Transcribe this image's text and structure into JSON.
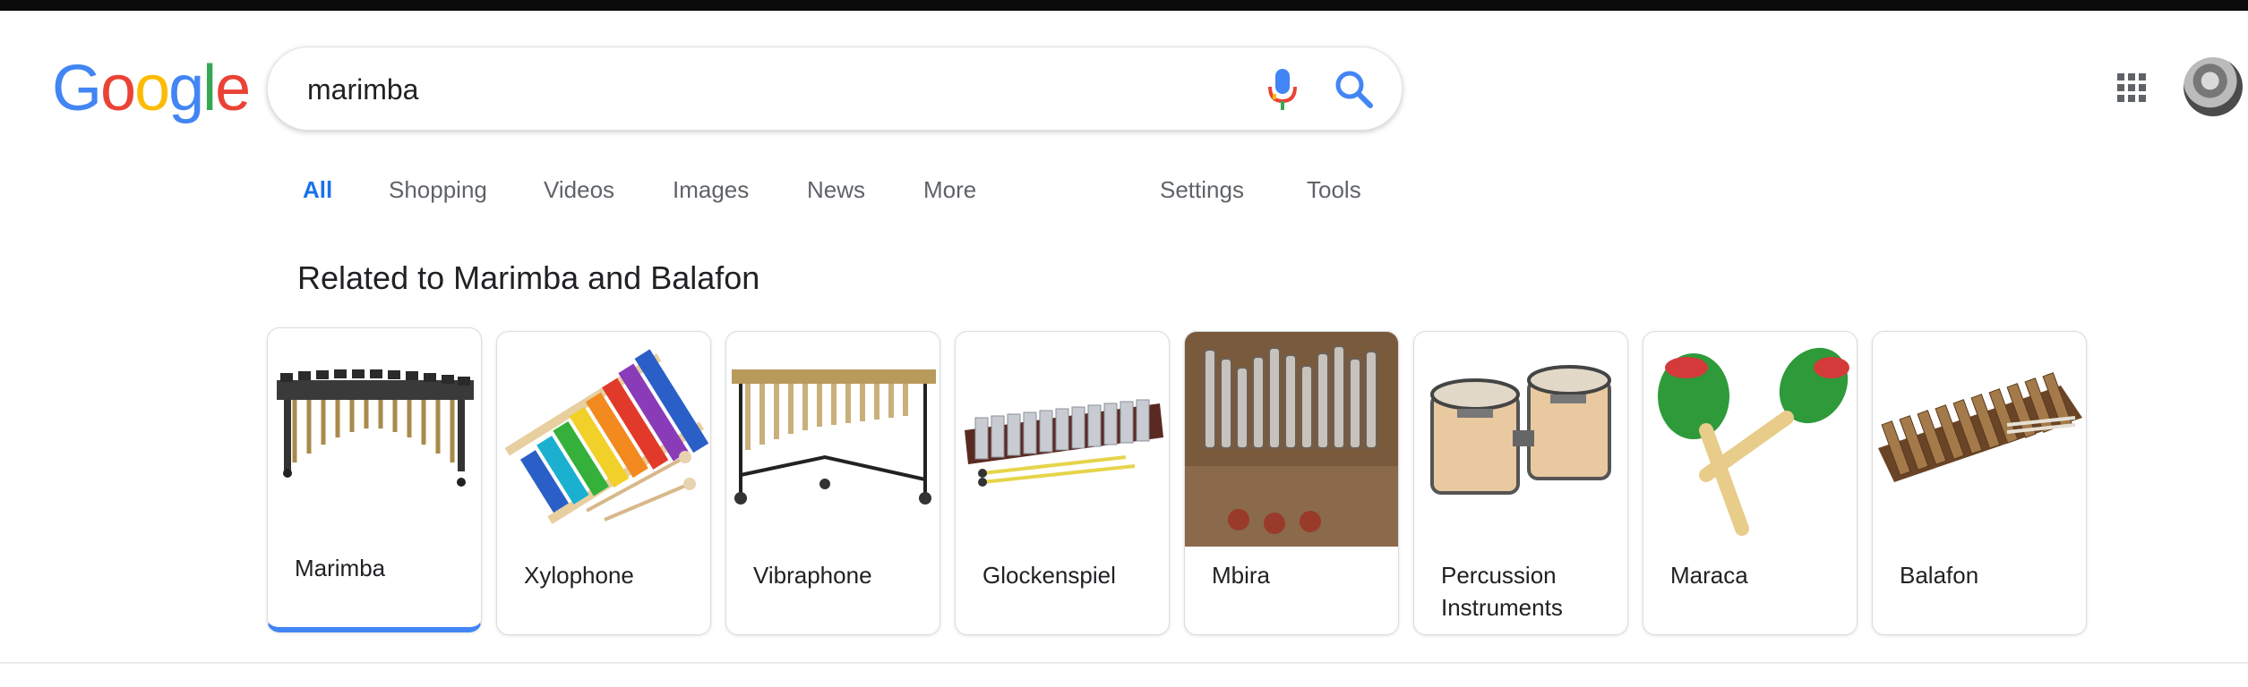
{
  "logo": {
    "letters": [
      "G",
      "o",
      "o",
      "g",
      "l",
      "e"
    ]
  },
  "search": {
    "query": "marimba"
  },
  "tabs": {
    "all": "All",
    "shopping": "Shopping",
    "videos": "Videos",
    "images": "Images",
    "news": "News",
    "more": "More",
    "settings": "Settings",
    "tools": "Tools"
  },
  "related": {
    "title": "Related to Marimba and Balafon",
    "items": [
      {
        "label": "Marimba"
      },
      {
        "label": "Xylophone"
      },
      {
        "label": "Vibraphone"
      },
      {
        "label": "Glockenspiel"
      },
      {
        "label": "Mbira"
      },
      {
        "label": "Percussion Instruments"
      },
      {
        "label": "Maraca"
      },
      {
        "label": "Balafon"
      }
    ]
  },
  "colors": {
    "accent": "#1a73e8",
    "selected_underline": "#4285F4"
  },
  "icons": [
    "mic-icon",
    "search-icon",
    "apps-grid-icon",
    "avatar"
  ]
}
